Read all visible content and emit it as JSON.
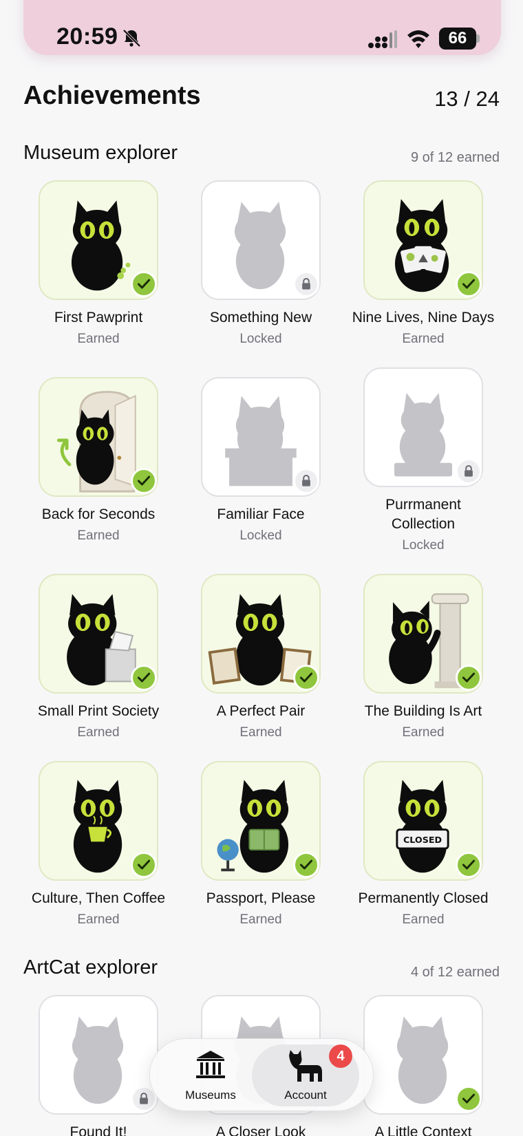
{
  "status_bar": {
    "time": "20:59",
    "battery": "66"
  },
  "header": {
    "title": "Achievements",
    "count": "13 / 24"
  },
  "sections": [
    {
      "title": "Museum explorer",
      "count": "9 of 12 earned",
      "badges": [
        {
          "name": "First Pawprint",
          "status": "Earned"
        },
        {
          "name": "Something New",
          "status": "Locked"
        },
        {
          "name": "Nine Lives, Nine Days",
          "status": "Earned"
        },
        {
          "name": "Back for Seconds",
          "status": "Earned"
        },
        {
          "name": "Familiar Face",
          "status": "Locked"
        },
        {
          "name": "Purrmanent Collection",
          "status": "Locked"
        },
        {
          "name": "Small Print Society",
          "status": "Earned"
        },
        {
          "name": "A Perfect Pair",
          "status": "Earned"
        },
        {
          "name": "The Building Is Art",
          "status": "Earned"
        },
        {
          "name": "Culture, Then Coffee",
          "status": "Earned"
        },
        {
          "name": "Passport, Please",
          "status": "Earned"
        },
        {
          "name": "Permanently Closed",
          "status": "Earned",
          "sign_text": "CLOSED"
        }
      ]
    },
    {
      "title": "ArtCat explorer",
      "count": "4 of 12 earned",
      "badges": [
        {
          "name": "Found It!"
        },
        {
          "name": "A Closer Look"
        },
        {
          "name": "A Little Context"
        }
      ]
    }
  ],
  "tab_bar": {
    "tabs": [
      {
        "label": "Museums",
        "icon": "museum-icon"
      },
      {
        "label": "Account",
        "icon": "cat-icon",
        "badge": "4"
      }
    ]
  },
  "colors": {
    "earned_tile": "#f5fae6",
    "earned_border": "#dfe8c2",
    "check_green": "#8fc63d",
    "cat_eye": "#c7e03a",
    "status_bar_bg": "#efcfdc",
    "notification_red": "#ec4a4a"
  }
}
